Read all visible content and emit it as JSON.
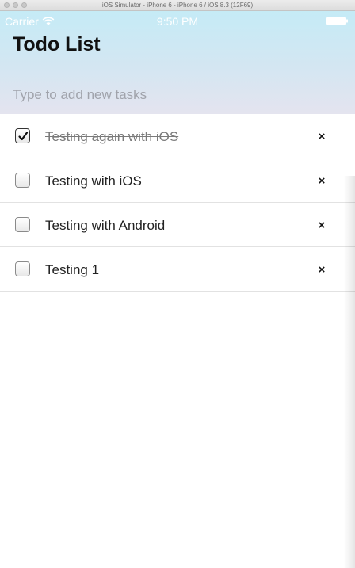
{
  "window": {
    "title": "iOS Simulator - iPhone 6 - iPhone 6 / iOS 8.3 (12F69)"
  },
  "status_bar": {
    "carrier": "Carrier",
    "time": "9:50 PM",
    "wifi_icon": "wifi-icon",
    "battery_icon": "battery-icon"
  },
  "app": {
    "title": "Todo List",
    "new_task": {
      "placeholder": "Type to add new tasks",
      "value": ""
    }
  },
  "tasks": [
    {
      "text": "Testing again with iOS",
      "completed": true,
      "delete_label": "×"
    },
    {
      "text": "Testing with iOS",
      "completed": false,
      "delete_label": "×"
    },
    {
      "text": "Testing with Android",
      "completed": false,
      "delete_label": "×"
    },
    {
      "text": "Testing 1",
      "completed": false,
      "delete_label": "×"
    }
  ],
  "colors": {
    "header_top": "#c5ebf6",
    "header_bottom": "#e4e4ef",
    "completed_text": "#7a7a7a"
  }
}
